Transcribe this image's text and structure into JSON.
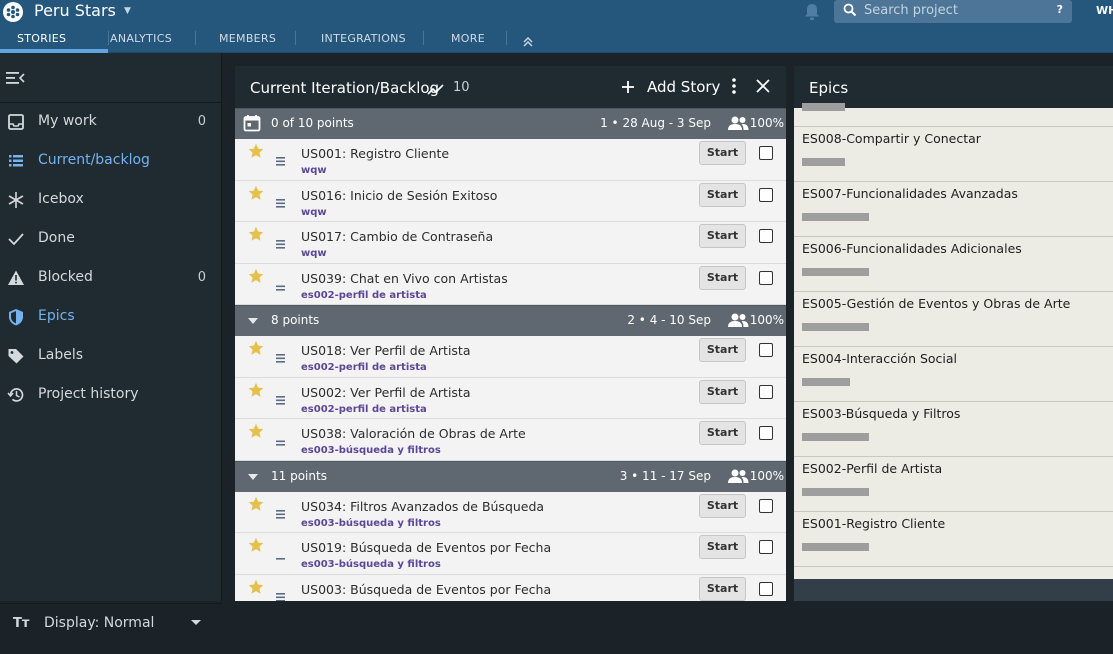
{
  "header": {
    "project_name": "Peru Stars",
    "search_placeholder": "Search project",
    "search_help": "?",
    "user_initials": "WH"
  },
  "nav": {
    "tabs": [
      "STORIES",
      "ANALYTICS",
      "MEMBERS",
      "INTEGRATIONS",
      "MORE"
    ]
  },
  "sidebar": {
    "items": [
      {
        "label": "My work",
        "count": "0",
        "icon": "inbox-icon"
      },
      {
        "label": "Current/backlog",
        "count": "",
        "icon": "list-icon"
      },
      {
        "label": "Icebox",
        "count": "",
        "icon": "snowflake-icon"
      },
      {
        "label": "Done",
        "count": "",
        "icon": "check-icon"
      },
      {
        "label": "Blocked",
        "count": "0",
        "icon": "warning-icon"
      },
      {
        "label": "Epics",
        "count": "",
        "icon": "shield-icon"
      },
      {
        "label": "Labels",
        "count": "",
        "icon": "tag-icon"
      },
      {
        "label": "Project history",
        "count": "",
        "icon": "history-icon"
      }
    ],
    "display_label": "Display: Normal"
  },
  "backlog": {
    "title": "Current Iteration/Backlog",
    "velocity": "10",
    "add_story": "Add Story",
    "start_label": "Start",
    "iterations": [
      {
        "points": "0 of 10 points",
        "dates": "1 • 28 Aug - 3 Sep",
        "percent": "100%",
        "current": true,
        "stories": [
          {
            "title": "US001: Registro Cliente",
            "label": "wqw",
            "estimate": 3
          },
          {
            "title": "US016: Inicio de Sesión Exitoso",
            "label": "wqw",
            "estimate": 3
          },
          {
            "title": "US017: Cambio de Contraseña",
            "label": "wqw",
            "estimate": 3
          },
          {
            "title": "US039: Chat en Vivo con Artistas",
            "label": "es002-perfil de artista",
            "estimate": 2
          }
        ]
      },
      {
        "points": "8 points",
        "dates": "2 • 4 - 10 Sep",
        "percent": "100%",
        "current": false,
        "stories": [
          {
            "title": "US018: Ver Perfil de Artista",
            "label": "es002-perfil de artista",
            "estimate": 3
          },
          {
            "title": "US002: Ver Perfil de Artista",
            "label": "es002-perfil de artista",
            "estimate": 3
          },
          {
            "title": "US038: Valoración de Obras de Arte",
            "label": "es003-búsqueda y filtros",
            "estimate": 2
          }
        ]
      },
      {
        "points": "11 points",
        "dates": "3 • 11 - 17 Sep",
        "percent": "100%",
        "current": false,
        "stories": [
          {
            "title": "US034: Filtros Avanzados de Búsqueda",
            "label": "es003-búsqueda y filtros",
            "estimate": 3
          },
          {
            "title": "US019: Búsqueda de Eventos por Fecha",
            "label": "es003-búsqueda y filtros",
            "estimate": 1
          },
          {
            "title": "US003: Búsqueda de Eventos por Fecha",
            "label": "",
            "estimate": 3
          }
        ]
      }
    ]
  },
  "epics": {
    "title": "Epics",
    "items": [
      {
        "name": "",
        "progress": 0.62
      },
      {
        "name": "ES008-Compartir y Conectar",
        "progress": 0.62
      },
      {
        "name": "ES007-Funcionalidades Avanzadas",
        "progress": 0.96
      },
      {
        "name": "ES006-Funcionalidades Adicionales",
        "progress": 0.96
      },
      {
        "name": "ES005-Gestión de Eventos y Obras de Arte",
        "progress": 0.96
      },
      {
        "name": "ES004-Interacción Social",
        "progress": 0.69
      },
      {
        "name": "ES003-Búsqueda y Filtros",
        "progress": 0.96
      },
      {
        "name": "ES002-Perfil de Artista",
        "progress": 0.96
      },
      {
        "name": "ES001-Registro Cliente",
        "progress": 0.96
      }
    ]
  },
  "colors": {
    "topbar": "#25577d",
    "sidebar": "#1f2a31",
    "accent": "#74b3ef",
    "iteration": "#5f6870",
    "label": "#5b4796",
    "star": "#e5c04c"
  }
}
